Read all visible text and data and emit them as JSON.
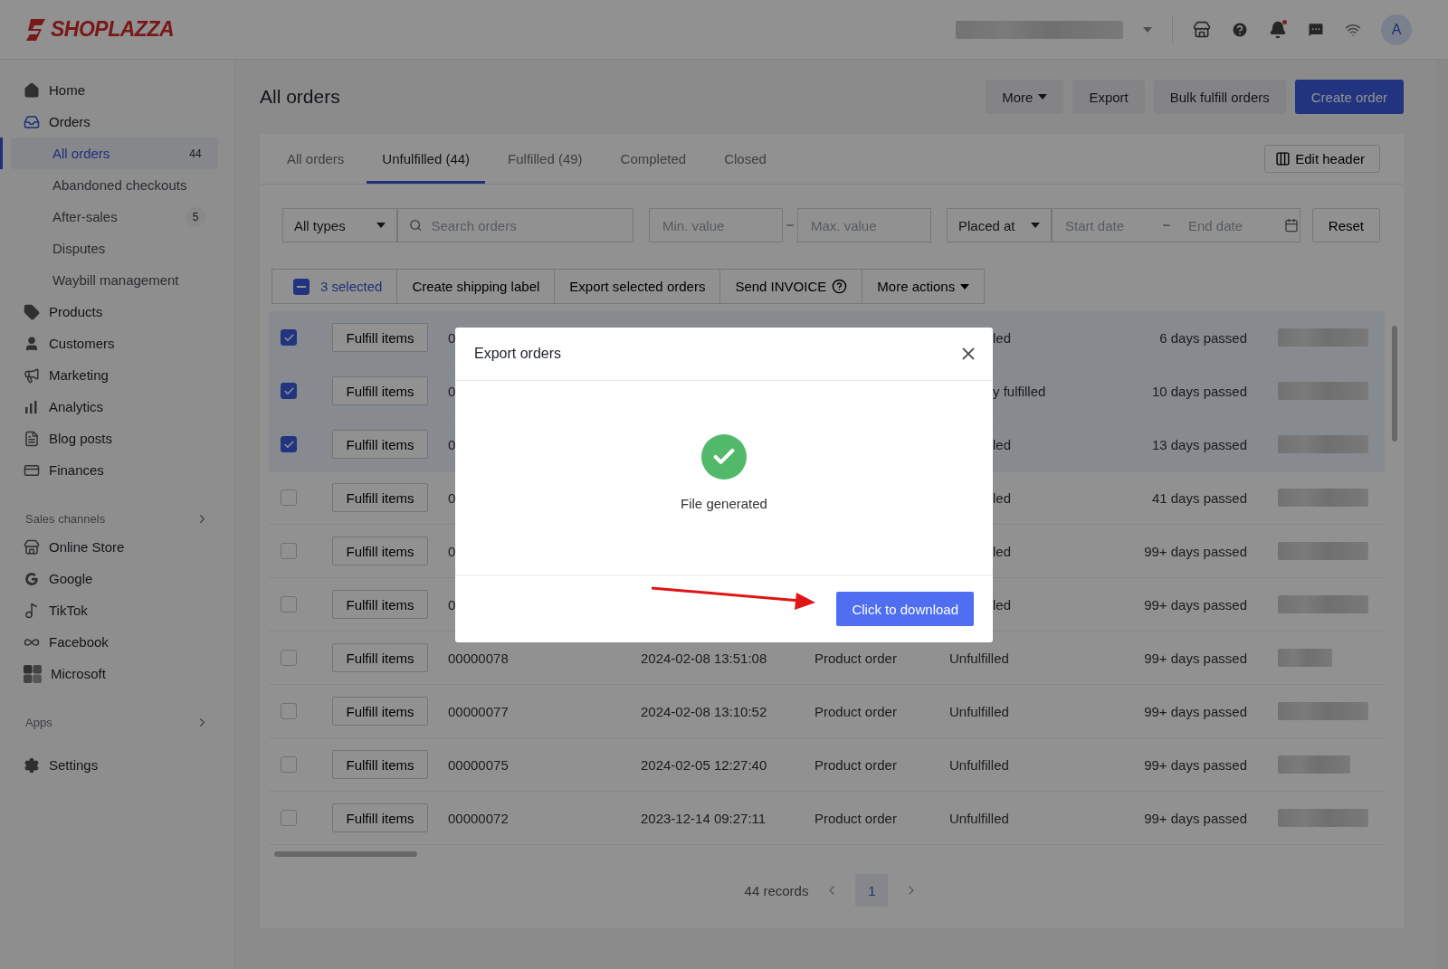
{
  "logo": {
    "text": "SHOPLAZZA"
  },
  "topbar": {
    "avatar": "A",
    "notification_dot": true
  },
  "sidebar": {
    "items": [
      {
        "kind": "item",
        "label": "Home",
        "selected": false
      },
      {
        "kind": "item",
        "label": "Orders",
        "selected": true,
        "expanded": true,
        "children": [
          {
            "label": "All orders",
            "selected": true,
            "badge": "44"
          },
          {
            "label": "Abandoned checkouts",
            "selected": false
          },
          {
            "label": "After-sales",
            "selected": false,
            "badge": "5"
          },
          {
            "label": "Disputes",
            "selected": false
          },
          {
            "label": "Waybill management",
            "selected": false
          }
        ]
      },
      {
        "kind": "item",
        "label": "Products",
        "selected": false
      },
      {
        "kind": "item",
        "label": "Customers",
        "selected": false
      },
      {
        "kind": "item",
        "label": "Marketing",
        "selected": false
      },
      {
        "kind": "item",
        "label": "Analytics",
        "selected": false
      },
      {
        "kind": "item",
        "label": "Blog posts",
        "selected": false
      },
      {
        "kind": "item",
        "label": "Finances",
        "selected": false
      },
      {
        "kind": "section",
        "label": "Sales channels"
      },
      {
        "kind": "item",
        "label": "Online Store",
        "selected": false
      },
      {
        "kind": "item",
        "label": "Google",
        "selected": false
      },
      {
        "kind": "item",
        "label": "TikTok",
        "selected": false
      },
      {
        "kind": "item",
        "label": "Facebook",
        "selected": false
      },
      {
        "kind": "item",
        "label": "Microsoft",
        "selected": false
      },
      {
        "kind": "section",
        "label": "Apps"
      },
      {
        "kind": "item",
        "label": "Settings",
        "selected": false
      }
    ]
  },
  "page": {
    "title": "All orders",
    "buttons": [
      {
        "label": "More",
        "kind": "dropdown"
      },
      {
        "label": "Export",
        "kind": "plain"
      },
      {
        "label": "Bulk fulfill orders",
        "kind": "plain"
      },
      {
        "label": "Create order",
        "kind": "primary"
      }
    ]
  },
  "tabs": [
    {
      "label": "All orders",
      "selected": false
    },
    {
      "label": "Unfulfilled (44)",
      "selected": true
    },
    {
      "label": "Fulfilled (49)",
      "selected": false
    },
    {
      "label": "Completed",
      "selected": false
    },
    {
      "label": "Closed",
      "selected": false
    }
  ],
  "edit_header": "Edit header",
  "filters": {
    "type": "All types",
    "search_placeholder": "Search orders",
    "min_placeholder": "Min. value",
    "max_placeholder": "Max. value",
    "date_field": "Placed at",
    "start_placeholder": "Start date",
    "end_placeholder": "End date",
    "reset": "Reset"
  },
  "bulk_bar": {
    "indeterminate": true,
    "selected_label": "3 selected",
    "actions": [
      {
        "label": "Create shipping label",
        "kind": "plain"
      },
      {
        "label": "Export selected orders",
        "kind": "plain"
      },
      {
        "label": "Send INVOICE",
        "kind": "help"
      },
      {
        "label": "More actions",
        "kind": "dropdown"
      }
    ]
  },
  "rows": [
    {
      "kind": "covered",
      "selected": true,
      "action": "Fulfill items",
      "order": "0",
      "status": "led",
      "age": "6 days passed"
    },
    {
      "kind": "covered",
      "selected": true,
      "action": "Fulfill items",
      "order": "0",
      "status": "y fulfilled",
      "age": "10 days passed"
    },
    {
      "kind": "covered",
      "selected": true,
      "action": "Fulfill items",
      "order": "0",
      "status": "led",
      "age": "13 days passed"
    },
    {
      "kind": "covered",
      "selected": false,
      "action": "Fulfill items",
      "order": "0",
      "status": "led",
      "age": "41 days passed"
    },
    {
      "kind": "covered",
      "selected": false,
      "action": "Fulfill items",
      "order": "0",
      "status": "led",
      "age": "99+ days passed"
    },
    {
      "kind": "covered",
      "selected": false,
      "action": "Fulfill items",
      "order": "0",
      "status": "led",
      "age": "99+ days passed"
    },
    {
      "kind": "full",
      "selected": false,
      "action": "Fulfill items",
      "order": "00000078",
      "placed": "2024-02-08 13:51:08",
      "type": "Product order",
      "status": "Unfulfilled",
      "age": "99+ days passed"
    },
    {
      "kind": "full",
      "selected": false,
      "action": "Fulfill items",
      "order": "00000077",
      "placed": "2024-02-08 13:10:52",
      "type": "Product order",
      "status": "Unfulfilled",
      "age": "99+ days passed"
    },
    {
      "kind": "full",
      "selected": false,
      "action": "Fulfill items",
      "order": "00000075",
      "placed": "2024-02-05 12:27:40",
      "type": "Product order",
      "status": "Unfulfilled",
      "age": "99+ days passed"
    },
    {
      "kind": "full",
      "selected": false,
      "action": "Fulfill items",
      "order": "00000072",
      "placed": "2023-12-14 09:27:11",
      "type": "Product order",
      "status": "Unfulfilled",
      "age": "99+ days passed"
    }
  ],
  "pagination": {
    "records": "44 records",
    "pages": [
      {
        "label": "1",
        "selected": true
      }
    ]
  },
  "modal": {
    "title": "Export orders",
    "message": "File generated",
    "button": "Click to download"
  }
}
